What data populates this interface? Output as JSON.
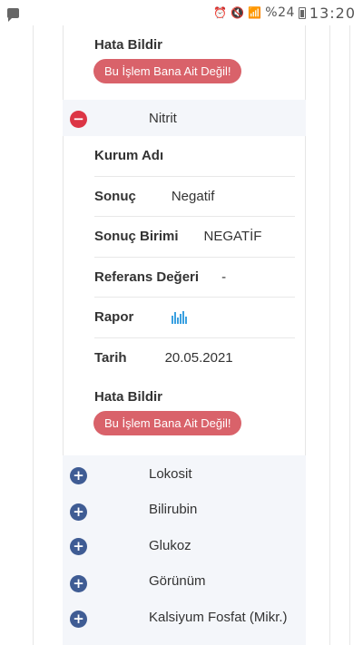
{
  "status_bar": {
    "battery_text": "%24",
    "time": "13:20"
  },
  "top_section": {
    "report_title": "Hata Bildir",
    "report_button": "Bu İşlem Bana Ait Değil!"
  },
  "expanded_section": {
    "name": "Nitrit",
    "expanded": true,
    "rows": {
      "kurum_label": "Kurum Adı",
      "kurum_value": "",
      "sonuc_label": "Sonuç",
      "sonuc_value": "Negatif",
      "birim_label": "Sonuç Birimi",
      "birim_value": "NEGATİF",
      "referans_label": "Referans Değeri",
      "referans_value": "-",
      "rapor_label": "Rapor",
      "rapor_icon": "bar-chart-icon",
      "tarih_label": "Tarih",
      "tarih_value": "20.05.2021"
    },
    "report_title": "Hata Bildir",
    "report_button": "Bu İşlem Bana Ait Değil!"
  },
  "collapsed_sections": [
    {
      "name": "Lokosit"
    },
    {
      "name": "Bilirubin"
    },
    {
      "name": "Glukoz"
    },
    {
      "name": "Görünüm"
    },
    {
      "name": "Kalsiyum Fosfat (Mikr.)"
    }
  ],
  "colors": {
    "report_button": "#d9626a",
    "collapse_icon": "#dc3545",
    "expand_icon": "#3f5c94",
    "section_bg": "#f4f6fa"
  }
}
